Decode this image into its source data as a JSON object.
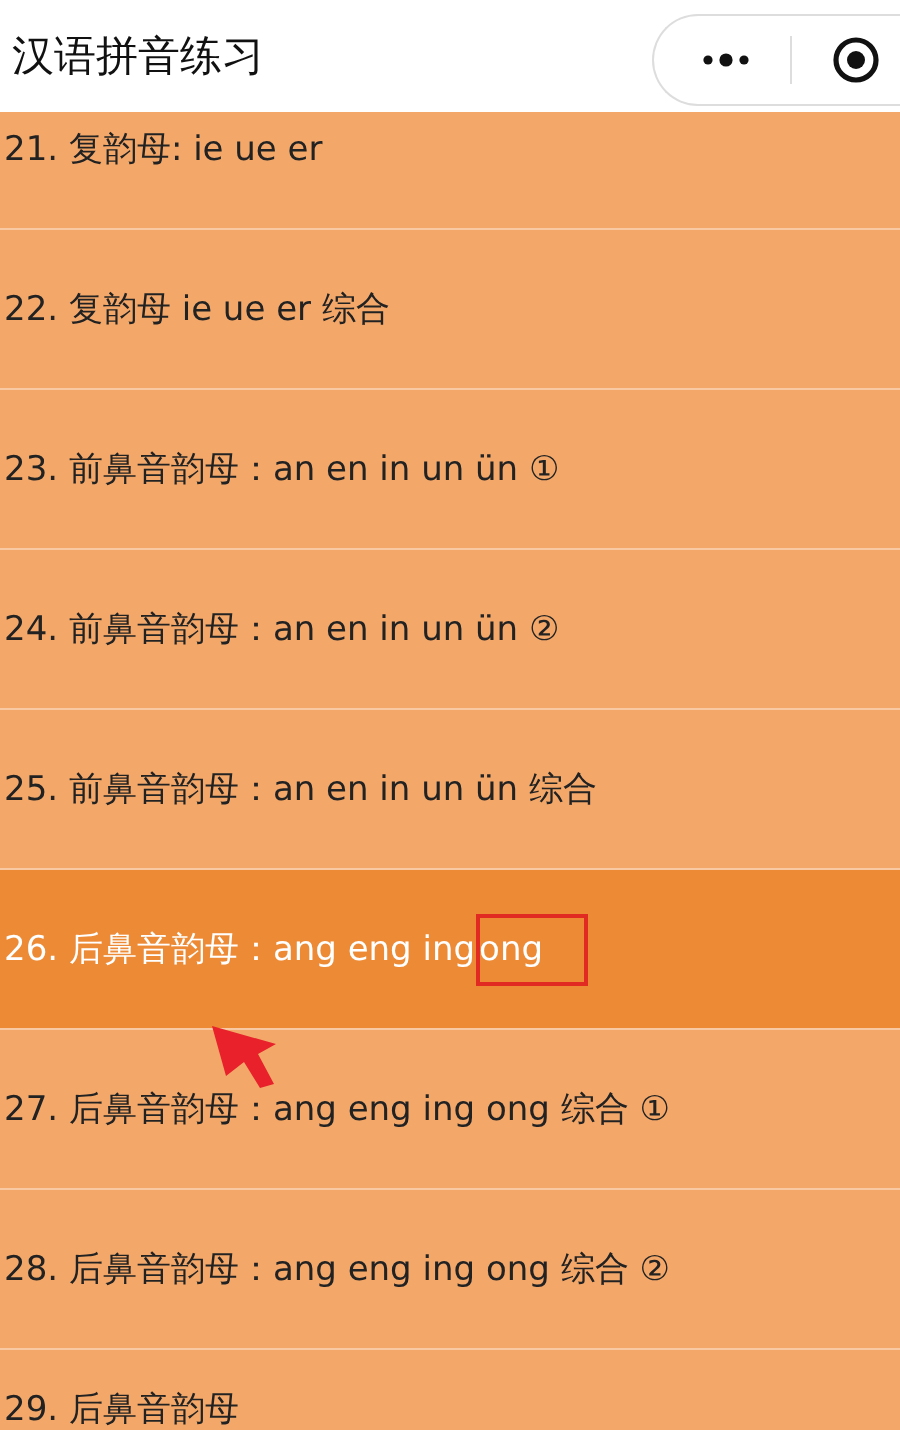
{
  "header": {
    "title": "汉语拼音练习"
  },
  "lessons": [
    {
      "text": "21. 复韵母: ie ue er",
      "selected": false
    },
    {
      "text": "22. 复韵母 ie ue er 综合",
      "selected": false
    },
    {
      "text": "23. 前鼻音韵母：an en in un ün ①",
      "selected": false
    },
    {
      "text": "24. 前鼻音韵母：an en in un ün ②",
      "selected": false
    },
    {
      "text": "25. 前鼻音韵母：an en in un ün 综合",
      "selected": false
    },
    {
      "text": "26. 后鼻音韵母：ang eng ing ",
      "boxed": "ong",
      "selected": true
    },
    {
      "text": "27. 后鼻音韵母：ang eng ing ong 综合 ①",
      "selected": false
    },
    {
      "text": "28. 后鼻音韵母：ang eng ing ong 综合 ②",
      "selected": false
    },
    {
      "text": "29. 后鼻音韵母",
      "selected": false
    }
  ]
}
